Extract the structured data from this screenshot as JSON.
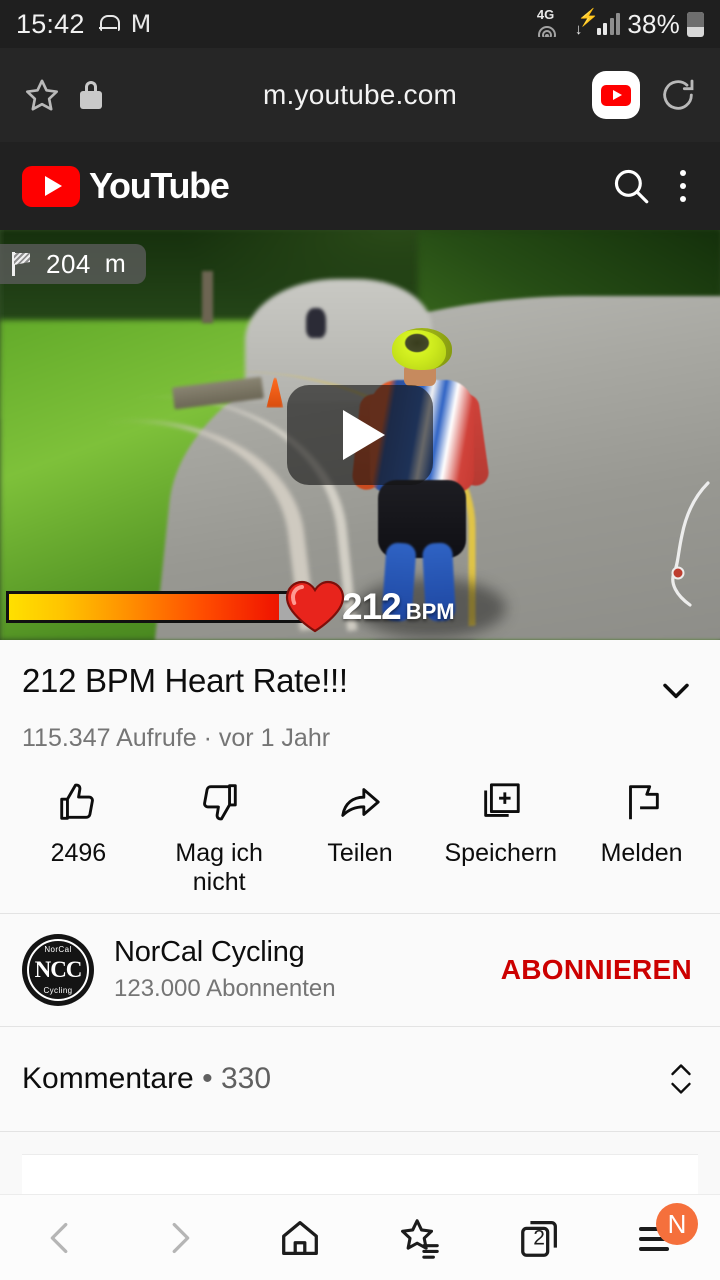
{
  "status_bar": {
    "time": "15:42",
    "battery_percent": "38%",
    "network_type": "4G",
    "icons": [
      "notification-bell-icon",
      "gmail-icon",
      "wifi-icon",
      "download-icon",
      "signal-bars-icon",
      "battery-icon"
    ]
  },
  "browser": {
    "url": "m.youtube.com",
    "bookmark_icon": "star-icon",
    "security_icon": "lock-icon",
    "app_chip_icon": "youtube-app-icon",
    "reload_icon": "reload-icon",
    "bottom_nav": {
      "back_label": "Zurück",
      "forward_label": "Vorwärts",
      "home_label": "Startseite",
      "bookmarks_label": "Lesezeichen",
      "tabs_count": "2",
      "menu_badge": "N"
    }
  },
  "yt_header": {
    "logo_text": "YouTube",
    "search_icon": "search-icon",
    "menu_icon": "more-vertical-icon"
  },
  "video": {
    "distance_badge": {
      "value": "204",
      "unit": "m",
      "icon": "checkered-flag-icon"
    },
    "heart_rate": {
      "value": "212",
      "unit": "BPM",
      "icon": "heart-icon",
      "bar_fill_percent": 92,
      "gradient": [
        "#ffe000",
        "#ff8c00",
        "#f21b00"
      ]
    },
    "play_button_icon": "play-icon"
  },
  "video_meta": {
    "title": "212 BPM Heart Rate!!!",
    "stats": "115.347 Aufrufe · vor 1 Jahr",
    "expand_icon": "chevron-down-icon"
  },
  "actions": [
    {
      "icon": "thumbs-up-icon",
      "label": "2496"
    },
    {
      "icon": "thumbs-down-icon",
      "label": "Mag ich nicht"
    },
    {
      "icon": "share-icon",
      "label": "Teilen"
    },
    {
      "icon": "save-icon",
      "label": "Speichern"
    },
    {
      "icon": "flag-icon",
      "label": "Melden"
    }
  ],
  "channel": {
    "avatar_text": "NCC",
    "avatar_top_text": "NorCal",
    "avatar_bottom_text": "Cycling",
    "name": "NorCal Cycling",
    "subscribers": "123.000 Abonnenten",
    "subscribe_label": "ABONNIEREN",
    "subscribe_color": "#cc0000"
  },
  "comments": {
    "label": "Kommentare",
    "separator": "•",
    "count": "330",
    "expand_icon": "expand-collapse-icon"
  }
}
